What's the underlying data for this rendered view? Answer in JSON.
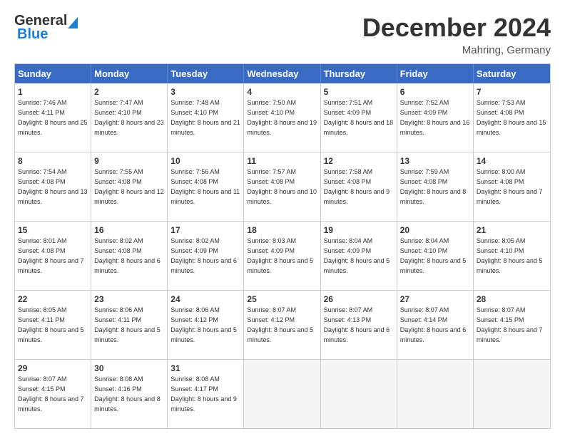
{
  "header": {
    "logo_general": "General",
    "logo_blue": "Blue",
    "month_title": "December 2024",
    "location": "Mahring, Germany"
  },
  "calendar": {
    "days": [
      "Sunday",
      "Monday",
      "Tuesday",
      "Wednesday",
      "Thursday",
      "Friday",
      "Saturday"
    ],
    "rows": [
      [
        {
          "day": "1",
          "sunrise": "7:46 AM",
          "sunset": "4:11 PM",
          "daylight": "8 hours and 25 minutes."
        },
        {
          "day": "2",
          "sunrise": "7:47 AM",
          "sunset": "4:10 PM",
          "daylight": "8 hours and 23 minutes."
        },
        {
          "day": "3",
          "sunrise": "7:48 AM",
          "sunset": "4:10 PM",
          "daylight": "8 hours and 21 minutes."
        },
        {
          "day": "4",
          "sunrise": "7:50 AM",
          "sunset": "4:10 PM",
          "daylight": "8 hours and 19 minutes."
        },
        {
          "day": "5",
          "sunrise": "7:51 AM",
          "sunset": "4:09 PM",
          "daylight": "8 hours and 18 minutes."
        },
        {
          "day": "6",
          "sunrise": "7:52 AM",
          "sunset": "4:09 PM",
          "daylight": "8 hours and 16 minutes."
        },
        {
          "day": "7",
          "sunrise": "7:53 AM",
          "sunset": "4:08 PM",
          "daylight": "8 hours and 15 minutes."
        }
      ],
      [
        {
          "day": "8",
          "sunrise": "7:54 AM",
          "sunset": "4:08 PM",
          "daylight": "8 hours and 13 minutes."
        },
        {
          "day": "9",
          "sunrise": "7:55 AM",
          "sunset": "4:08 PM",
          "daylight": "8 hours and 12 minutes."
        },
        {
          "day": "10",
          "sunrise": "7:56 AM",
          "sunset": "4:08 PM",
          "daylight": "8 hours and 11 minutes."
        },
        {
          "day": "11",
          "sunrise": "7:57 AM",
          "sunset": "4:08 PM",
          "daylight": "8 hours and 10 minutes."
        },
        {
          "day": "12",
          "sunrise": "7:58 AM",
          "sunset": "4:08 PM",
          "daylight": "8 hours and 9 minutes."
        },
        {
          "day": "13",
          "sunrise": "7:59 AM",
          "sunset": "4:08 PM",
          "daylight": "8 hours and 8 minutes."
        },
        {
          "day": "14",
          "sunrise": "8:00 AM",
          "sunset": "4:08 PM",
          "daylight": "8 hours and 7 minutes."
        }
      ],
      [
        {
          "day": "15",
          "sunrise": "8:01 AM",
          "sunset": "4:08 PM",
          "daylight": "8 hours and 7 minutes."
        },
        {
          "day": "16",
          "sunrise": "8:02 AM",
          "sunset": "4:08 PM",
          "daylight": "8 hours and 6 minutes."
        },
        {
          "day": "17",
          "sunrise": "8:02 AM",
          "sunset": "4:09 PM",
          "daylight": "8 hours and 6 minutes."
        },
        {
          "day": "18",
          "sunrise": "8:03 AM",
          "sunset": "4:09 PM",
          "daylight": "8 hours and 5 minutes."
        },
        {
          "day": "19",
          "sunrise": "8:04 AM",
          "sunset": "4:09 PM",
          "daylight": "8 hours and 5 minutes."
        },
        {
          "day": "20",
          "sunrise": "8:04 AM",
          "sunset": "4:10 PM",
          "daylight": "8 hours and 5 minutes."
        },
        {
          "day": "21",
          "sunrise": "8:05 AM",
          "sunset": "4:10 PM",
          "daylight": "8 hours and 5 minutes."
        }
      ],
      [
        {
          "day": "22",
          "sunrise": "8:05 AM",
          "sunset": "4:11 PM",
          "daylight": "8 hours and 5 minutes."
        },
        {
          "day": "23",
          "sunrise": "8:06 AM",
          "sunset": "4:11 PM",
          "daylight": "8 hours and 5 minutes."
        },
        {
          "day": "24",
          "sunrise": "8:06 AM",
          "sunset": "4:12 PM",
          "daylight": "8 hours and 5 minutes."
        },
        {
          "day": "25",
          "sunrise": "8:07 AM",
          "sunset": "4:12 PM",
          "daylight": "8 hours and 5 minutes."
        },
        {
          "day": "26",
          "sunrise": "8:07 AM",
          "sunset": "4:13 PM",
          "daylight": "8 hours and 6 minutes."
        },
        {
          "day": "27",
          "sunrise": "8:07 AM",
          "sunset": "4:14 PM",
          "daylight": "8 hours and 6 minutes."
        },
        {
          "day": "28",
          "sunrise": "8:07 AM",
          "sunset": "4:15 PM",
          "daylight": "8 hours and 7 minutes."
        }
      ],
      [
        {
          "day": "29",
          "sunrise": "8:07 AM",
          "sunset": "4:15 PM",
          "daylight": "8 hours and 7 minutes."
        },
        {
          "day": "30",
          "sunrise": "8:08 AM",
          "sunset": "4:16 PM",
          "daylight": "8 hours and 8 minutes."
        },
        {
          "day": "31",
          "sunrise": "8:08 AM",
          "sunset": "4:17 PM",
          "daylight": "8 hours and 9 minutes."
        },
        null,
        null,
        null,
        null
      ]
    ],
    "labels": {
      "sunrise": "Sunrise:",
      "sunset": "Sunset:",
      "daylight": "Daylight:"
    }
  }
}
